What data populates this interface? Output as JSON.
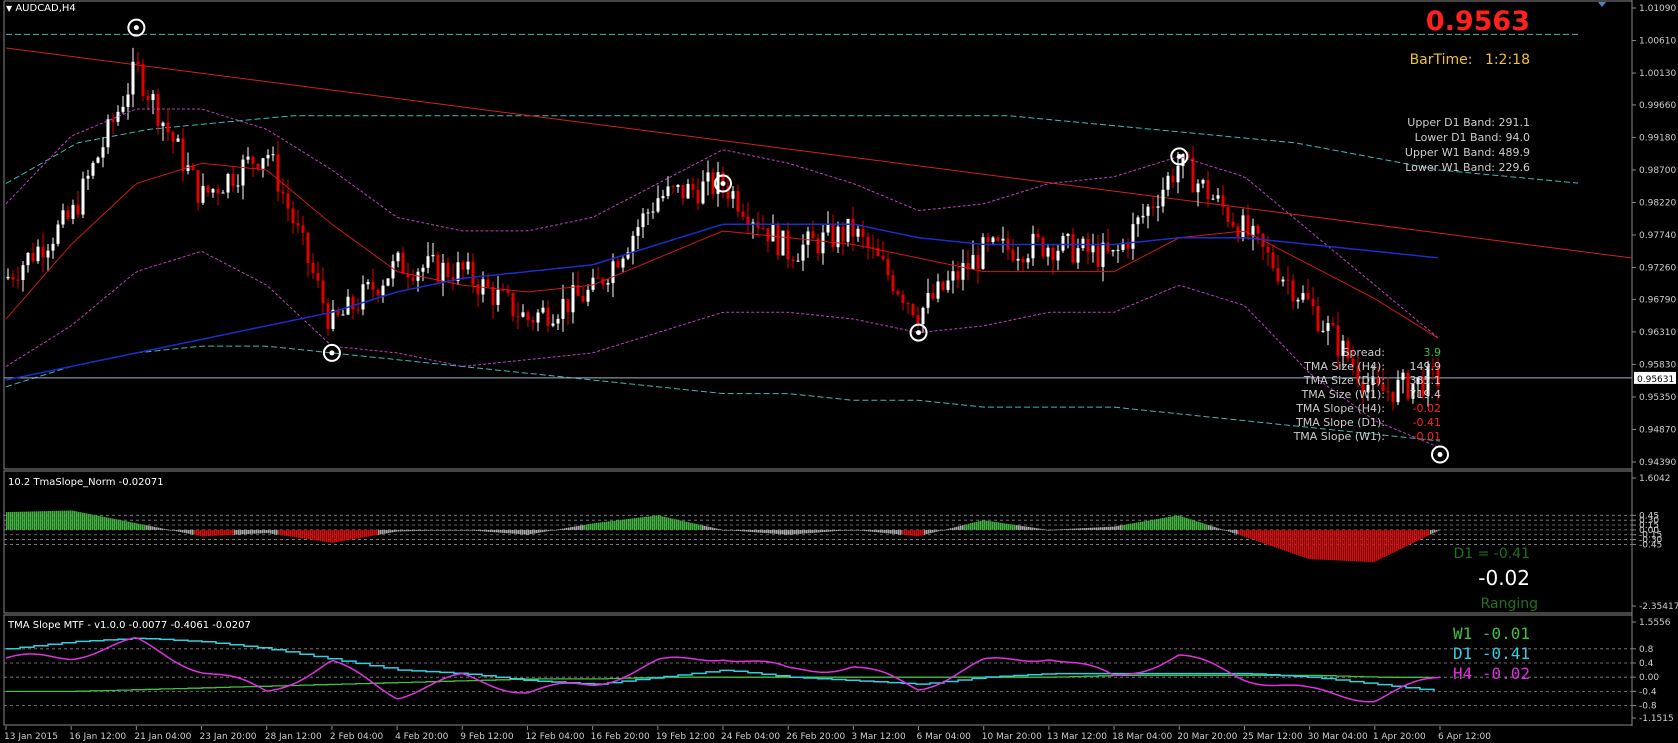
{
  "colors": {
    "bull": "#ffffff",
    "bear": "#e00000",
    "tma_mid": "#d01818",
    "slow_ma": "#1a2ecc",
    "band": "#c040c0",
    "outer": "#3fb8b8",
    "trend": "#d02020",
    "pos_hist": "#40b040",
    "neg_hist": "#d01010",
    "flat_hist": "#a8a8a8",
    "w1": "#40c040",
    "d1": "#30d0e0",
    "h4": "#e030e0",
    "price_red": "#ff2020",
    "bartime": "#f0c030"
  },
  "main": {
    "symbol": "AUDCAD,H4",
    "price": "0.9563",
    "bartime_label": "BarTime:",
    "bartime_value": "1:2:18",
    "bands": [
      "Upper D1 Band: 291.1",
      "Lower D1 Band: 94.0",
      "Upper W1 Band: 489.9",
      "Lower W1 Band: 229.6"
    ],
    "stats": [
      {
        "label": "Spread:",
        "value": "3.9",
        "color": "#40c040"
      },
      {
        "label": "TMA Size (H4):",
        "value": "149.9",
        "color": "#cccccc"
      },
      {
        "label": "TMA Size (D1):",
        "value": "385.1",
        "color": "#cccccc"
      },
      {
        "label": "TMA Size (W1):",
        "value": "719.4",
        "color": "#cccccc"
      },
      {
        "label": "TMA Slope (H4):",
        "value": "-0.02",
        "color": "#ff2020"
      },
      {
        "label": "TMA Slope (D1):",
        "value": "-0.41",
        "color": "#ff2020"
      },
      {
        "label": "TMA Slope (W1):",
        "value": "-0.01",
        "color": "#ff2020"
      }
    ],
    "price_axis": [
      "1.01090",
      "1.00610",
      "1.00130",
      "0.99660",
      "0.99180",
      "0.98700",
      "0.98220",
      "0.97740",
      "0.97260",
      "0.96790",
      "0.96310",
      "0.95830",
      "0.95350",
      "0.94870",
      "0.94390"
    ],
    "current_price_tag": "0.95631"
  },
  "tma_slope_norm": {
    "title": "10.2 TmaSlope_Norm -0.02071",
    "axis": [
      "1.6042",
      "0.45",
      "0.30",
      "0.15",
      "0.00",
      "-0.15",
      "-0.30",
      "-0.45",
      "-2.35417"
    ],
    "d1_text": "D1 = -0.41",
    "value_text": "-0.02",
    "state": "Ranging"
  },
  "tma_mtf": {
    "title": "TMA Slope MTF - v1.0.0 -0.0077 -0.4061 -0.0207",
    "axis": [
      "1.5556",
      "0.8",
      "0.4",
      "0.00",
      "-0.4",
      "-0.8",
      "-1.1515"
    ],
    "w1_text": "W1 -0.01",
    "d1_text": "D1 -0.41",
    "h4_text": "H4 -0.02"
  },
  "time_axis": [
    "13 Jan 2015",
    "16 Jan 12:00",
    "21 Jan 04:00",
    "23 Jan 20:00",
    "28 Jan 12:00",
    "2 Feb 04:00",
    "4 Feb 20:00",
    "9 Feb 12:00",
    "12 Feb 04:00",
    "16 Feb 20:00",
    "19 Feb 12:00",
    "24 Feb 04:00",
    "26 Feb 20:00",
    "3 Mar 12:00",
    "6 Mar 04:00",
    "10 Mar 20:00",
    "13 Mar 12:00",
    "18 Mar 04:00",
    "20 Mar 20:00",
    "25 Mar 12:00",
    "30 Mar 04:00",
    "1 Apr 20:00",
    "6 Apr 12:00"
  ],
  "chart_data": {
    "type": "line",
    "symbol": "AUDCAD,H4",
    "x_categories": [
      "13 Jan 2015",
      "16 Jan 12:00",
      "21 Jan 04:00",
      "23 Jan 20:00",
      "28 Jan 12:00",
      "2 Feb 04:00",
      "4 Feb 20:00",
      "9 Feb 12:00",
      "12 Feb 04:00",
      "16 Feb 20:00",
      "19 Feb 12:00",
      "24 Feb 04:00",
      "26 Feb 20:00",
      "3 Mar 12:00",
      "6 Mar 04:00",
      "10 Mar 20:00",
      "13 Mar 12:00",
      "18 Mar 04:00",
      "20 Mar 20:00",
      "25 Mar 12:00",
      "30 Mar 04:00",
      "1 Apr 20:00",
      "6 Apr 12:00"
    ],
    "ylim": [
      0.9439,
      1.0109
    ],
    "price_approx": [
      0.971,
      0.98,
      1.002,
      0.983,
      0.99,
      0.964,
      0.973,
      0.972,
      0.965,
      0.969,
      0.983,
      0.985,
      0.975,
      0.978,
      0.966,
      0.975,
      0.976,
      0.974,
      0.988,
      0.978,
      0.967,
      0.954,
      0.9563
    ],
    "tma_mid_approx": [
      0.965,
      0.976,
      0.985,
      0.988,
      0.987,
      0.979,
      0.972,
      0.97,
      0.969,
      0.97,
      0.974,
      0.978,
      0.977,
      0.976,
      0.974,
      0.972,
      0.972,
      0.972,
      0.977,
      0.978,
      0.973,
      0.968,
      0.962
    ],
    "slow_ma_approx": [
      0.956,
      0.958,
      0.96,
      0.962,
      0.964,
      0.966,
      0.969,
      0.971,
      0.972,
      0.973,
      0.976,
      0.979,
      0.979,
      0.979,
      0.977,
      0.976,
      0.976,
      0.976,
      0.977,
      0.977,
      0.976,
      0.975,
      0.974
    ],
    "upper_band_approx": [
      0.982,
      0.992,
      0.996,
      0.996,
      0.993,
      0.987,
      0.98,
      0.978,
      0.978,
      0.98,
      0.985,
      0.99,
      0.988,
      0.985,
      0.981,
      0.982,
      0.985,
      0.986,
      0.989,
      0.986,
      0.978,
      0.97,
      0.962
    ],
    "lower_band_approx": [
      0.958,
      0.964,
      0.972,
      0.975,
      0.97,
      0.961,
      0.96,
      0.958,
      0.959,
      0.96,
      0.963,
      0.966,
      0.966,
      0.965,
      0.963,
      0.964,
      0.966,
      0.966,
      0.97,
      0.967,
      0.957,
      0.95,
      0.946
    ],
    "outer_upper_approx": [
      1.007,
      1.007,
      1.007,
      1.007,
      1.007,
      1.007,
      1.007,
      1.007,
      1.007,
      1.007,
      1.007,
      1.007,
      1.007,
      1.007,
      1.007,
      1.007,
      1.007,
      1.007,
      1.007,
      1.007,
      1.007,
      1.007,
      1.007
    ],
    "outer_mid_upper_approx": [
      0.985,
      0.991,
      0.993,
      0.994,
      0.995,
      0.995,
      0.995,
      0.995,
      0.995,
      0.995,
      0.995,
      0.995,
      0.995,
      0.995,
      0.995,
      0.994,
      0.993,
      0.992,
      0.991,
      0.989,
      0.987,
      0.986,
      0.985
    ],
    "outer_lower_approx": [
      0.955,
      0.958,
      0.96,
      0.961,
      0.961,
      0.96,
      0.959,
      0.958,
      0.957,
      0.956,
      0.955,
      0.954,
      0.954,
      0.953,
      0.953,
      0.952,
      0.952,
      0.952,
      0.951,
      0.95,
      0.949,
      0.948,
      0.947
    ],
    "trendline": [
      {
        "x": "13 Jan 2015",
        "y": 1.005
      },
      {
        "x": "6 Apr 12:00",
        "y": 0.974
      }
    ],
    "pivot_markers": [
      {
        "x": "21 Jan 04:00",
        "y": 1.008
      },
      {
        "x": "2 Feb 04:00",
        "y": 0.96
      },
      {
        "x": "24 Feb 04:00",
        "y": 0.985
      },
      {
        "x": "6 Mar 04:00",
        "y": 0.963
      },
      {
        "x": "20 Mar 20:00",
        "y": 0.989
      },
      {
        "x": "6 Apr 12:00",
        "y": 0.945
      }
    ],
    "tma_slope_norm_approx": [
      0.55,
      0.6,
      0.2,
      -0.2,
      -0.1,
      -0.4,
      -0.05,
      0.0,
      -0.15,
      0.2,
      0.45,
      0.0,
      -0.15,
      0.0,
      -0.2,
      0.3,
      0.0,
      0.1,
      0.45,
      -0.2,
      -0.9,
      -1.0,
      -0.02
    ],
    "w1_approx": [
      -0.4,
      -0.4,
      -0.35,
      -0.3,
      -0.25,
      -0.2,
      -0.15,
      -0.1,
      -0.05,
      -0.05,
      0.0,
      0.0,
      0.0,
      0.0,
      0.0,
      0.0,
      0.0,
      0.05,
      0.05,
      0.05,
      0.05,
      0.0,
      -0.01
    ],
    "d1_approx": [
      0.8,
      1.0,
      1.1,
      1.0,
      0.8,
      0.5,
      0.2,
      0.1,
      -0.1,
      -0.2,
      0.0,
      0.2,
      0.0,
      -0.1,
      -0.2,
      0.0,
      0.1,
      0.1,
      0.1,
      0.1,
      0.0,
      -0.2,
      -0.41
    ],
    "h4_approx": [
      0.5,
      0.6,
      1.0,
      0.2,
      -0.4,
      0.4,
      -0.5,
      0.0,
      -0.4,
      -0.2,
      0.4,
      0.6,
      0.2,
      0.3,
      -0.3,
      0.4,
      0.6,
      0.0,
      0.6,
      0.0,
      -0.4,
      -0.6,
      -0.02
    ]
  }
}
